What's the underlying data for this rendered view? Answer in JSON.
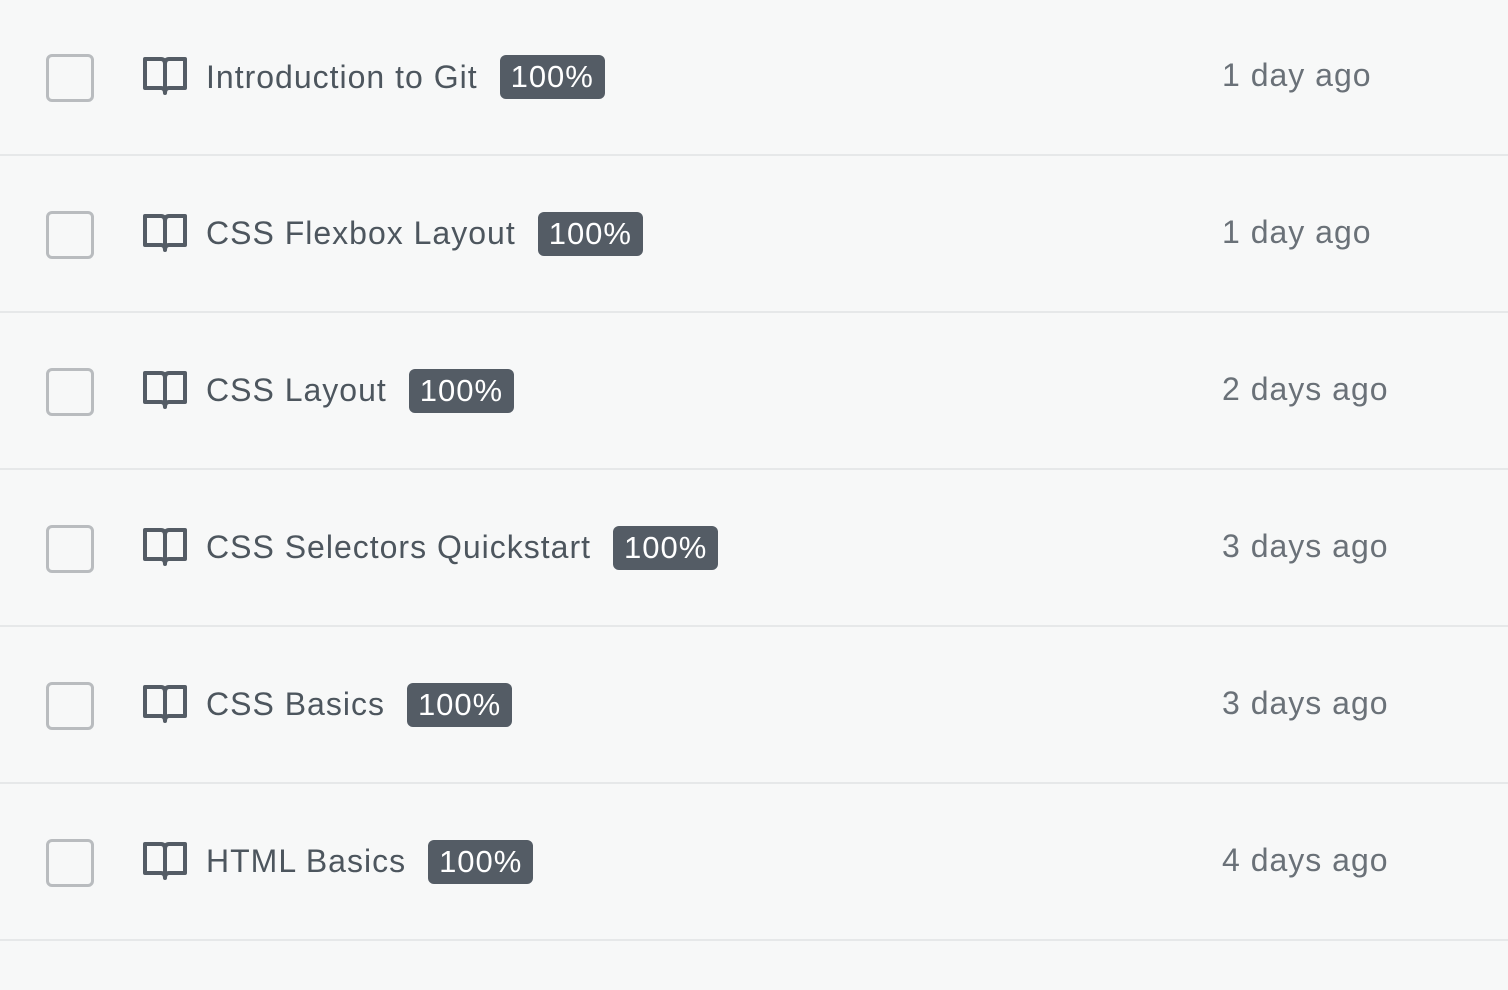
{
  "items": [
    {
      "title": "Introduction to Git",
      "progress": "100%",
      "time": "1 day ago",
      "checked": false
    },
    {
      "title": "CSS Flexbox Layout",
      "progress": "100%",
      "time": "1 day ago",
      "checked": false
    },
    {
      "title": "CSS Layout",
      "progress": "100%",
      "time": "2 days ago",
      "checked": false
    },
    {
      "title": "CSS Selectors Quickstart",
      "progress": "100%",
      "time": "3 days ago",
      "checked": false
    },
    {
      "title": "CSS Basics",
      "progress": "100%",
      "time": "3 days ago",
      "checked": false
    },
    {
      "title": "HTML Basics",
      "progress": "100%",
      "time": "4 days ago",
      "checked": false
    }
  ],
  "icons": {
    "row_icon": "book-open-icon"
  },
  "colors": {
    "background": "#f7f8f8",
    "badge_background": "#545c65",
    "title_text": "#4d565e",
    "time_text": "#6a7178",
    "checkbox_border": "#b9bcbf",
    "divider": "#e6e8e9"
  }
}
